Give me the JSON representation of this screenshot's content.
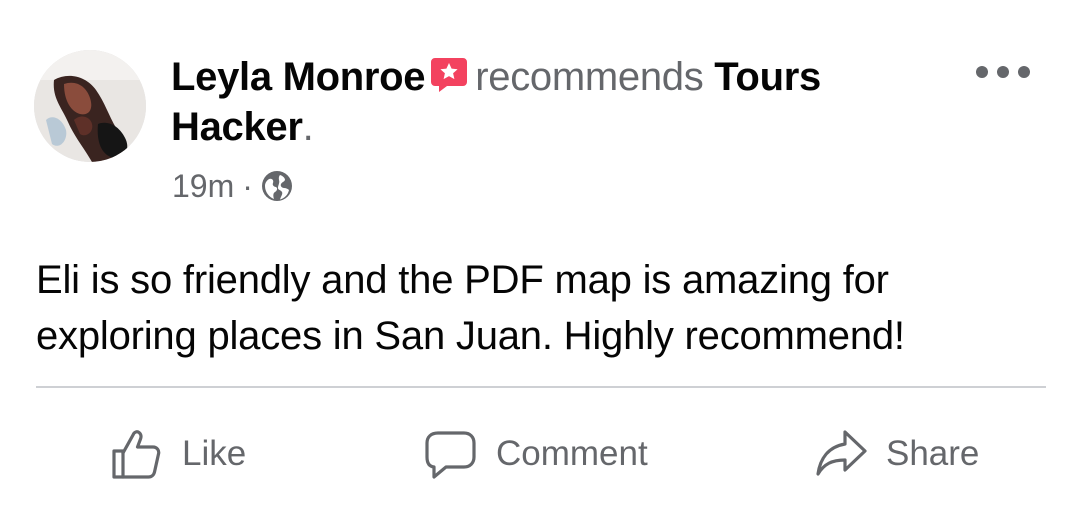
{
  "post": {
    "author": "Leyla Monroe",
    "verb": "recommends",
    "page_name": "Tours Hacker",
    "period": ".",
    "time": "19m",
    "separator": "·",
    "privacy_icon": "globe-icon",
    "recommendation_icon": "recommendation-badge-icon",
    "body": "Eli is so friendly and the PDF map is amazing for exploring places in San Juan. Highly recommend!"
  },
  "actions": {
    "like_label": "Like",
    "comment_label": "Comment",
    "share_label": "Share"
  },
  "colors": {
    "primary_text": "#050505",
    "secondary_text": "#65676b",
    "recommend_badge": "#f3425f",
    "divider": "#ced0d4"
  }
}
